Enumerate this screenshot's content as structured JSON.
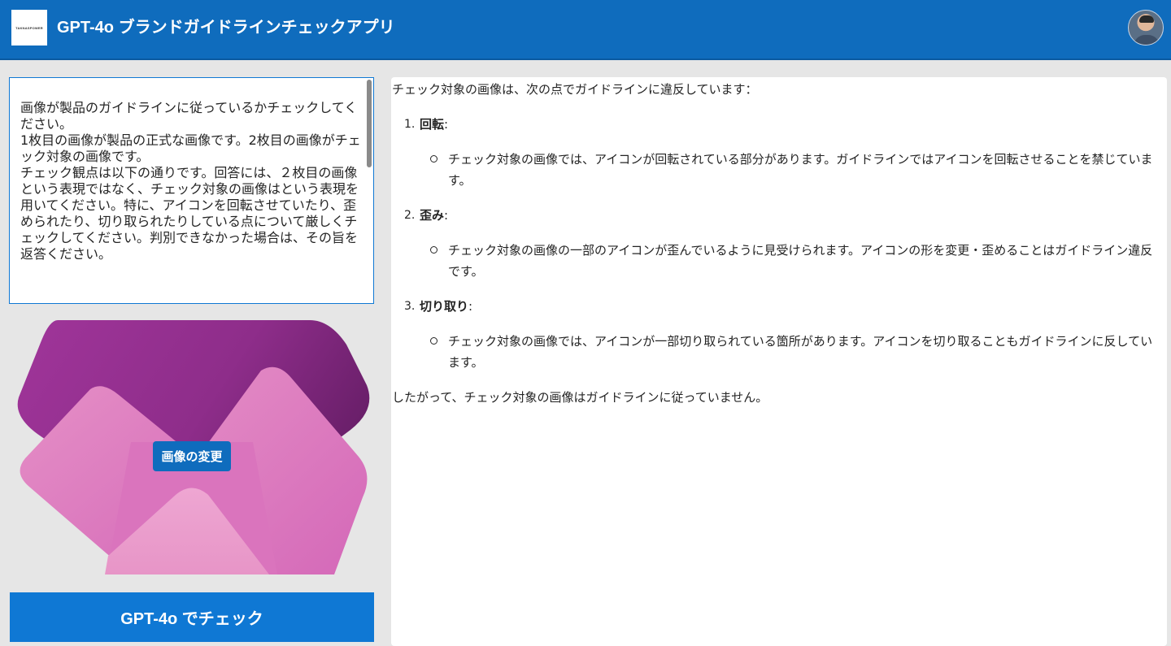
{
  "header": {
    "logo_text": "TAKNASPOWER",
    "title": "GPT-4o ブランドガイドラインチェックアプリ"
  },
  "prompt": {
    "lines": [
      "画像が製品のガイドラインに従っているかチェックしてください。",
      "1枚目の画像が製品の正式な画像です。2枚目の画像がチェック対象の画像です。",
      "チェック観点は以下の通りです。回答には、２枚目の画像という表現ではなく、チェック対象の画像はという表現を用いてください。特に、アイコンを回転させていたり、歪められたり、切り取られたりしている点について厳しくチェックしてください。判別できなかった場合は、その旨を返答ください。"
    ]
  },
  "image_panel": {
    "change_button_label": "画像の変更",
    "colors": {
      "back_shape": "#8e2d8a",
      "front_shape": "#d86fbd",
      "highlight": "#eaa0cc"
    }
  },
  "check_button_label": "GPT-4o でチェック",
  "result": {
    "intro": "チェック対象の画像は、次の点でガイドラインに違反しています：",
    "items": [
      {
        "number": "1.",
        "title": "回転",
        "suffix": ":",
        "detail": "チェック対象の画像では、アイコンが回転されている部分があります。ガイドラインではアイコンを回転させることを禁じています。"
      },
      {
        "number": "2.",
        "title": "歪み",
        "suffix": ":",
        "detail": "チェック対象の画像の一部のアイコンが歪んでいるように見受けられます。アイコンの形を変更・歪めることはガイドライン違反です。"
      },
      {
        "number": "3.",
        "title": "切り取り",
        "suffix": ":",
        "detail": "チェック対象の画像では、アイコンが一部切り取られている箇所があります。アイコンを切り取ることもガイドラインに反しています。"
      }
    ],
    "conclusion": "したがって、チェック対象の画像はガイドラインに従っていません。"
  },
  "colors": {
    "header_bg": "#0f6cbd",
    "primary_button": "#0f78d4",
    "page_bg": "#e6e6e6"
  }
}
